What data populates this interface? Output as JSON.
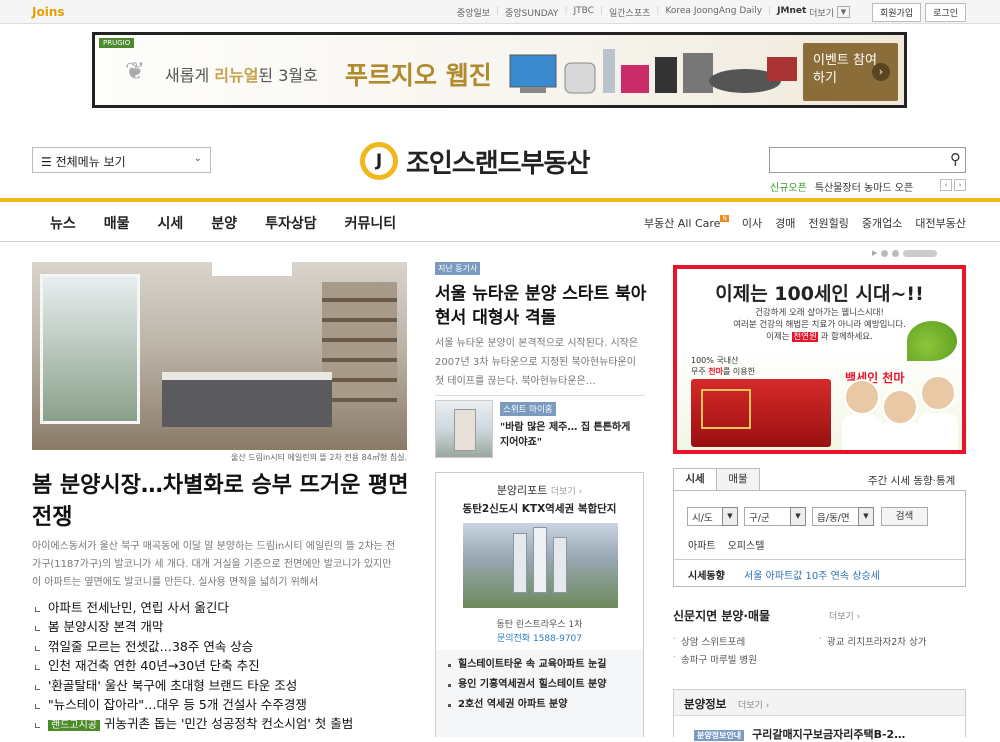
{
  "topbar": {
    "logo": "Joins",
    "links": [
      "중앙일보",
      "중앙SUNDAY",
      "JTBC",
      "일간스포츠",
      "Korea JoongAng Daily"
    ],
    "jmnet": "JMnet",
    "more": "더보기",
    "signup": "회원가입",
    "login": "로그인"
  },
  "banner": {
    "brand": "PRUGIO",
    "text_prefix": "새롭게 ",
    "text_highlight": "리뉴얼",
    "text_suffix": "된 3월호",
    "title": "푸르지오 웹진",
    "event": "이벤트 참여하기"
  },
  "header": {
    "menu": "전체메뉴 보기",
    "logo_mark": "J",
    "site_name": "조인스랜드부동산",
    "search_placeholder": "",
    "promo_new": "신규오픈",
    "promo_text": "특산물장터 농마드 오픈"
  },
  "nav": {
    "left": [
      "뉴스",
      "매물",
      "시세",
      "분양",
      "투자상담",
      "커뮤니티"
    ],
    "right": [
      "부동산 All Care",
      "이사",
      "경매",
      "전원힐링",
      "중개업소",
      "대전부동산"
    ],
    "new_badge": "N"
  },
  "main_story": {
    "caption": "울산 드림in시티 에일린의 뜰 2차 전용 84㎡형 침실.",
    "headline": "봄 분양시장…차별화로 승부 뜨거운 평면 전쟁",
    "summary": "아이에스동서가 울산 북구 매곡동에 이달 말 분양하는 드림in시티 에일린의 뜰 2차는 전 가구(1187가구)의 발코니가 세 개다. 대개 거실을 기준으로 전면에만 발코니가 있지만 이 아파트는 옆면에도 발코니를 만든다. 실사용 면적을 넓히기 위해서",
    "list": [
      {
        "tag": "",
        "text": "아파트 전세난민, 연립 사서 옮긴다"
      },
      {
        "tag": "",
        "text": "봄 분양시장 본격 개막"
      },
      {
        "tag": "",
        "text": "꺾일줄 모르는 전셋값…38주 연속 상승"
      },
      {
        "tag": "",
        "text": "인천 재건축 연한 40년→30년 단축 추진"
      },
      {
        "tag": "",
        "text": "'환골탈태' 울산 북구에 초대형 브랜드 타운 조성"
      },
      {
        "tag": "",
        "text": "\"뉴스테이 잡아라\"…대우 등 5개 건설사 수주경쟁"
      },
      {
        "tag": "랜드고시공",
        "text": "귀농귀촌 돕는 '민간 성공정착 컨소시엄' 첫 출범"
      }
    ]
  },
  "mid": {
    "tag": "지난 동기사",
    "headline": "서울 뉴타운 분양 스타트 북아현서 대형사 격돌",
    "summary": "서울 뉴타운 분양이 본격적으로 시작된다. 시작은 2007년 3차 뉴타운으로 지정된 북아현뉴타운이 첫 테이프를 끊는다. 북아현뉴타운은…",
    "thumb_tag": "스위트 마이홈",
    "thumb_text": "\"바람 많은 제주… 집 튼튼하게 지어야죠\"",
    "report": {
      "title": "분양리포트",
      "more": "더보기 ›",
      "subtitle": "동탄2신도시 KTX역세권 복합단지",
      "caption": "동탄 린스트라우스 1차",
      "phone": "문의전화 1588-9707",
      "list": [
        "힐스테이트타운 속 교육아파트 눈길",
        "용인 기흥역세권서 힐스테이트 분양",
        "2호선 역세권 아파트 분양"
      ]
    }
  },
  "right": {
    "ad": {
      "title": "이제는 100세인 시대~!!",
      "sub1": "건강하게 오래 살아가는 웰니스시대!",
      "sub2": "여러분 건강의 해법은 치료가 아니라 예방입니다.",
      "sub3_pre": "이제는 ",
      "sub3_hl": "천연원",
      "sub3_post": " 과 함께하세요.",
      "small1": "100% 국내산",
      "small2_pre": "무주 ",
      "small2_hl": "천마",
      "small2_post": "를 이용한",
      "product": "백세인 천마"
    },
    "tabs": [
      "시세",
      "매물"
    ],
    "weekly": "주간 시세 동향·통계",
    "selects": [
      "시/도",
      "구/군",
      "읍/동/면"
    ],
    "search_btn": "검색",
    "links": [
      "아파트",
      "오피스텔"
    ],
    "trend_label": "시세동향",
    "trend_value": "서울 아파트값 10주 연속 상승세",
    "np_title": "신문지면 분양·매물",
    "np_more": "더보기 ›",
    "np_items": [
      "상암 스위트포레",
      "광교 리치프라자2차 상가",
      "송파구 마루빌 병원"
    ],
    "bs_title": "분양정보",
    "bs_more": "더보기 ›",
    "bs_tag": "분양정보안내",
    "bs_text": "구리갈매지구보금자리주택B-2…"
  },
  "colors": {
    "accent": "#f2b917",
    "ad_border": "#e8142a",
    "link": "#2a6fb5",
    "tag_green": "#4d8a2a"
  }
}
